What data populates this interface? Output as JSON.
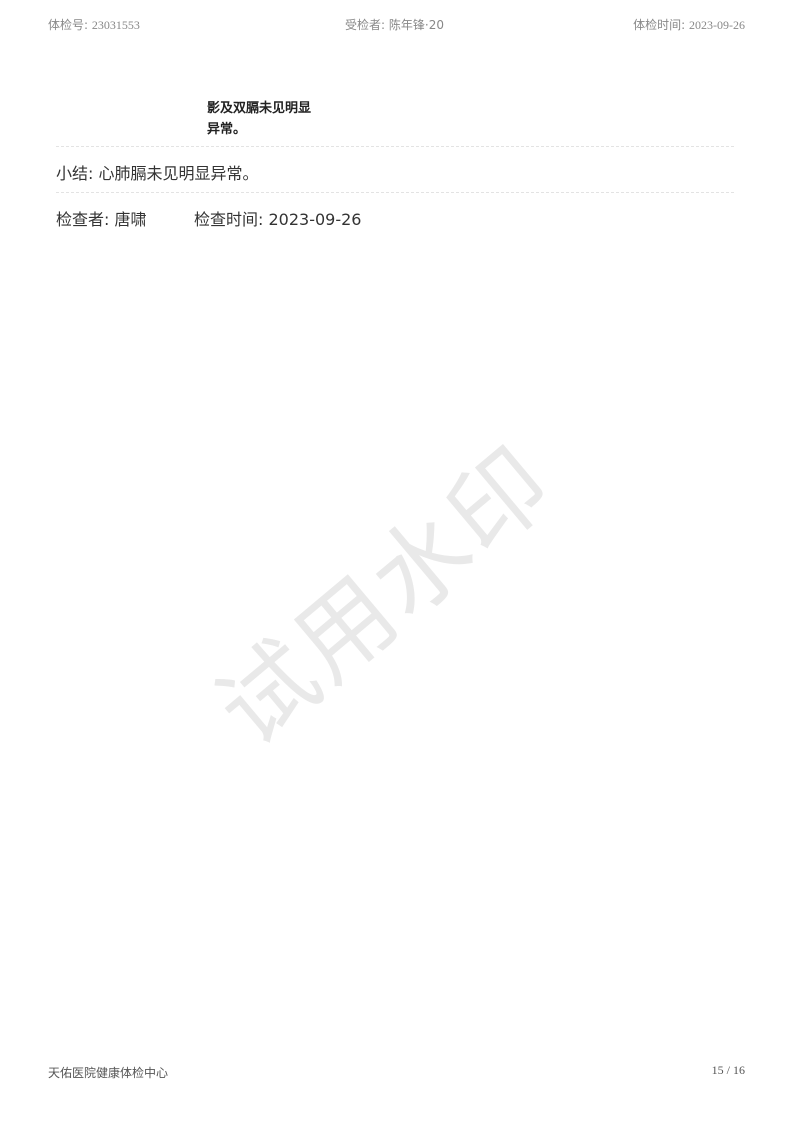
{
  "header": {
    "exam_no_label": "体检号:",
    "exam_no": "23031553",
    "patient_label": "受检者:",
    "patient_name": "陈年锋·20",
    "exam_date_label": "体检时间:",
    "exam_date": "2023-09-26"
  },
  "result": {
    "line1": "影及双膈未见明显",
    "line2": "异常。"
  },
  "summary": {
    "label": "小结:",
    "text": "心肺膈未见明显异常。"
  },
  "examiner": {
    "label": "检查者:",
    "name": "唐啸",
    "time_label": "检查时间:",
    "time": "2023-09-26"
  },
  "watermark": "试用水印",
  "footer": {
    "organization": "天佑医院健康体检中心",
    "page": "15 / 16"
  }
}
